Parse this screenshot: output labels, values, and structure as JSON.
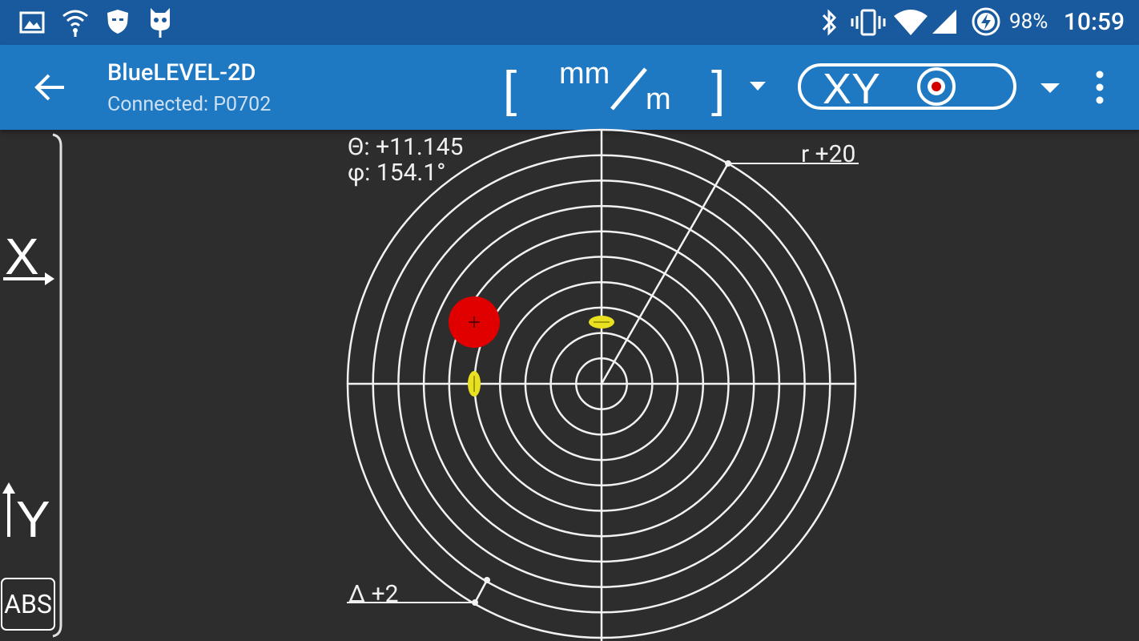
{
  "status_bar": {
    "time": "10:59",
    "battery_percent": "98%",
    "icons": [
      "image-icon",
      "wifi-icon",
      "shield-icon",
      "cyanogen-icon",
      "bluetooth-icon",
      "vibrate-icon",
      "wifi-signal-icon",
      "cell-signal-icon",
      "battery-charging-icon"
    ]
  },
  "app_bar": {
    "title": "BlueLEVEL-2D",
    "subtitle": "Connected: P0702",
    "unit": {
      "open_bracket": "[",
      "numerator": "mm",
      "denominator": "m",
      "close_bracket": "]"
    },
    "mode": {
      "label": "XY"
    }
  },
  "left_panel": {
    "x_label": "X",
    "y_label": "Y",
    "abs_label": "ABS"
  },
  "readouts": {
    "theta": "Θ: +11.145",
    "phi": "φ: 154.1°"
  },
  "plot": {
    "r_label": "r +20",
    "delta_label": "Δ +2",
    "ring_count": 10,
    "bubble_color": "#e00000",
    "marker_color": "#e8e020",
    "theta_value": 11.145,
    "phi_deg": 154.1
  }
}
